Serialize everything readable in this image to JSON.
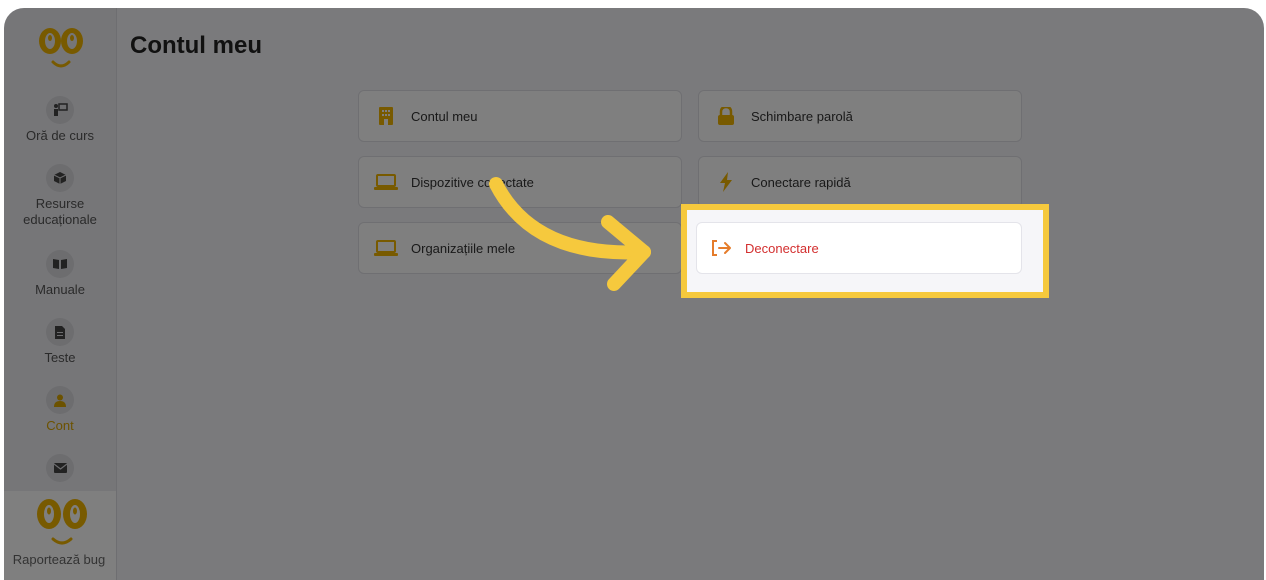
{
  "page": {
    "title": "Contul meu"
  },
  "sidebar": {
    "items": [
      {
        "label": "Oră de curs",
        "icon": "chalkboard-teacher-icon",
        "active": false
      },
      {
        "label": "Resurse educaționale",
        "icon": "cube-icon",
        "active": false
      },
      {
        "label": "Manuale",
        "icon": "book-open-icon",
        "active": false
      },
      {
        "label": "Teste",
        "icon": "file-icon",
        "active": false
      },
      {
        "label": "Cont",
        "icon": "user-icon",
        "active": true
      },
      {
        "label": "",
        "icon": "envelope-icon",
        "active": false
      }
    ],
    "report_bug": "Raportează bug"
  },
  "cards": {
    "account": "Contul meu",
    "change_password": "Schimbare parolă",
    "devices": "Dispozitive conectate",
    "quick_connect": "Conectare rapidă",
    "organizations": "Organizațiile mele",
    "logout": "Deconectare"
  },
  "colors": {
    "accent": "#f6c93d",
    "brand_yellow": "#f0b400",
    "logout_red": "#d32f2f",
    "active_nav": "#d9a400"
  }
}
